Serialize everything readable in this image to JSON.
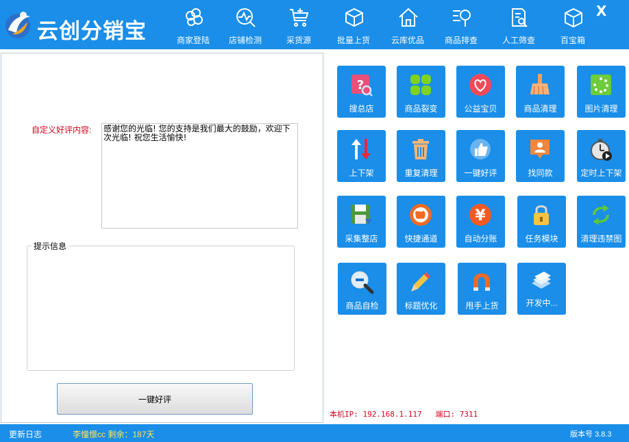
{
  "app": {
    "title": "云创分销宝"
  },
  "window": {
    "close_label": "X"
  },
  "nav": [
    {
      "label": "商家登陆",
      "icon": "cloud-icon"
    },
    {
      "label": "店铺检测",
      "icon": "chart-search-icon"
    },
    {
      "label": "采货源",
      "icon": "cart-add-icon"
    },
    {
      "label": "批量上货",
      "icon": "cube-upload-icon"
    },
    {
      "label": "云库优品",
      "icon": "house-icon"
    },
    {
      "label": "商品排查",
      "icon": "sort-search-icon"
    },
    {
      "label": "人工筛查",
      "icon": "document-search-icon"
    },
    {
      "label": "百宝箱",
      "icon": "box-icon"
    }
  ],
  "form": {
    "custom_label": "自定义好评内容:",
    "comment_text": "感谢您的光临! 您的支持是我们最大的鼓励，欢迎下次光临! 祝您生活愉快!",
    "hint_title": "提示信息",
    "submit_label": "一键好评"
  },
  "tools": [
    {
      "label": "搜总店",
      "icon": "search-store-icon"
    },
    {
      "label": "商品裂变",
      "icon": "clover-icon"
    },
    {
      "label": "公益宝贝",
      "icon": "heart-icon"
    },
    {
      "label": "商品清理",
      "icon": "broom-icon"
    },
    {
      "label": "图片清理",
      "icon": "loading-image-icon"
    },
    {
      "label": "上下架",
      "icon": "up-down-arrows-icon"
    },
    {
      "label": "重复清理",
      "icon": "trash-icon"
    },
    {
      "label": "一键好评",
      "icon": "thumbs-up-icon"
    },
    {
      "label": "找同款",
      "icon": "person-tag-icon"
    },
    {
      "label": "定时上下架",
      "icon": "stopwatch-icon"
    },
    {
      "label": "采集整店",
      "icon": "save-disk-icon"
    },
    {
      "label": "快捷通道",
      "icon": "globe-icon"
    },
    {
      "label": "自动分账",
      "icon": "yuan-icon"
    },
    {
      "label": "任务模块",
      "icon": "padlock-icon"
    },
    {
      "label": "清理违禁图",
      "icon": "refresh-icon"
    },
    {
      "label": "商品自检",
      "icon": "magnifier-minus-icon"
    },
    {
      "label": "标题优化",
      "icon": "pencil-icon"
    },
    {
      "label": "甩手上货",
      "icon": "magnet-icon"
    },
    {
      "label": "开发中...",
      "icon": "stack-icon"
    }
  ],
  "network": {
    "ip_label": "本机IP:",
    "ip": "192.168.1.117",
    "port_label": "端口:",
    "port": "7311"
  },
  "status": {
    "changelog": "更新日志",
    "user": "李憧憬cc",
    "remaining": "剩余：187天",
    "version_label": "版本号",
    "version": "3.8.3"
  },
  "colors": {
    "primary": "#1a8ee8",
    "warning_red": "#d0021b",
    "user_yellow": "#ffe45c"
  }
}
